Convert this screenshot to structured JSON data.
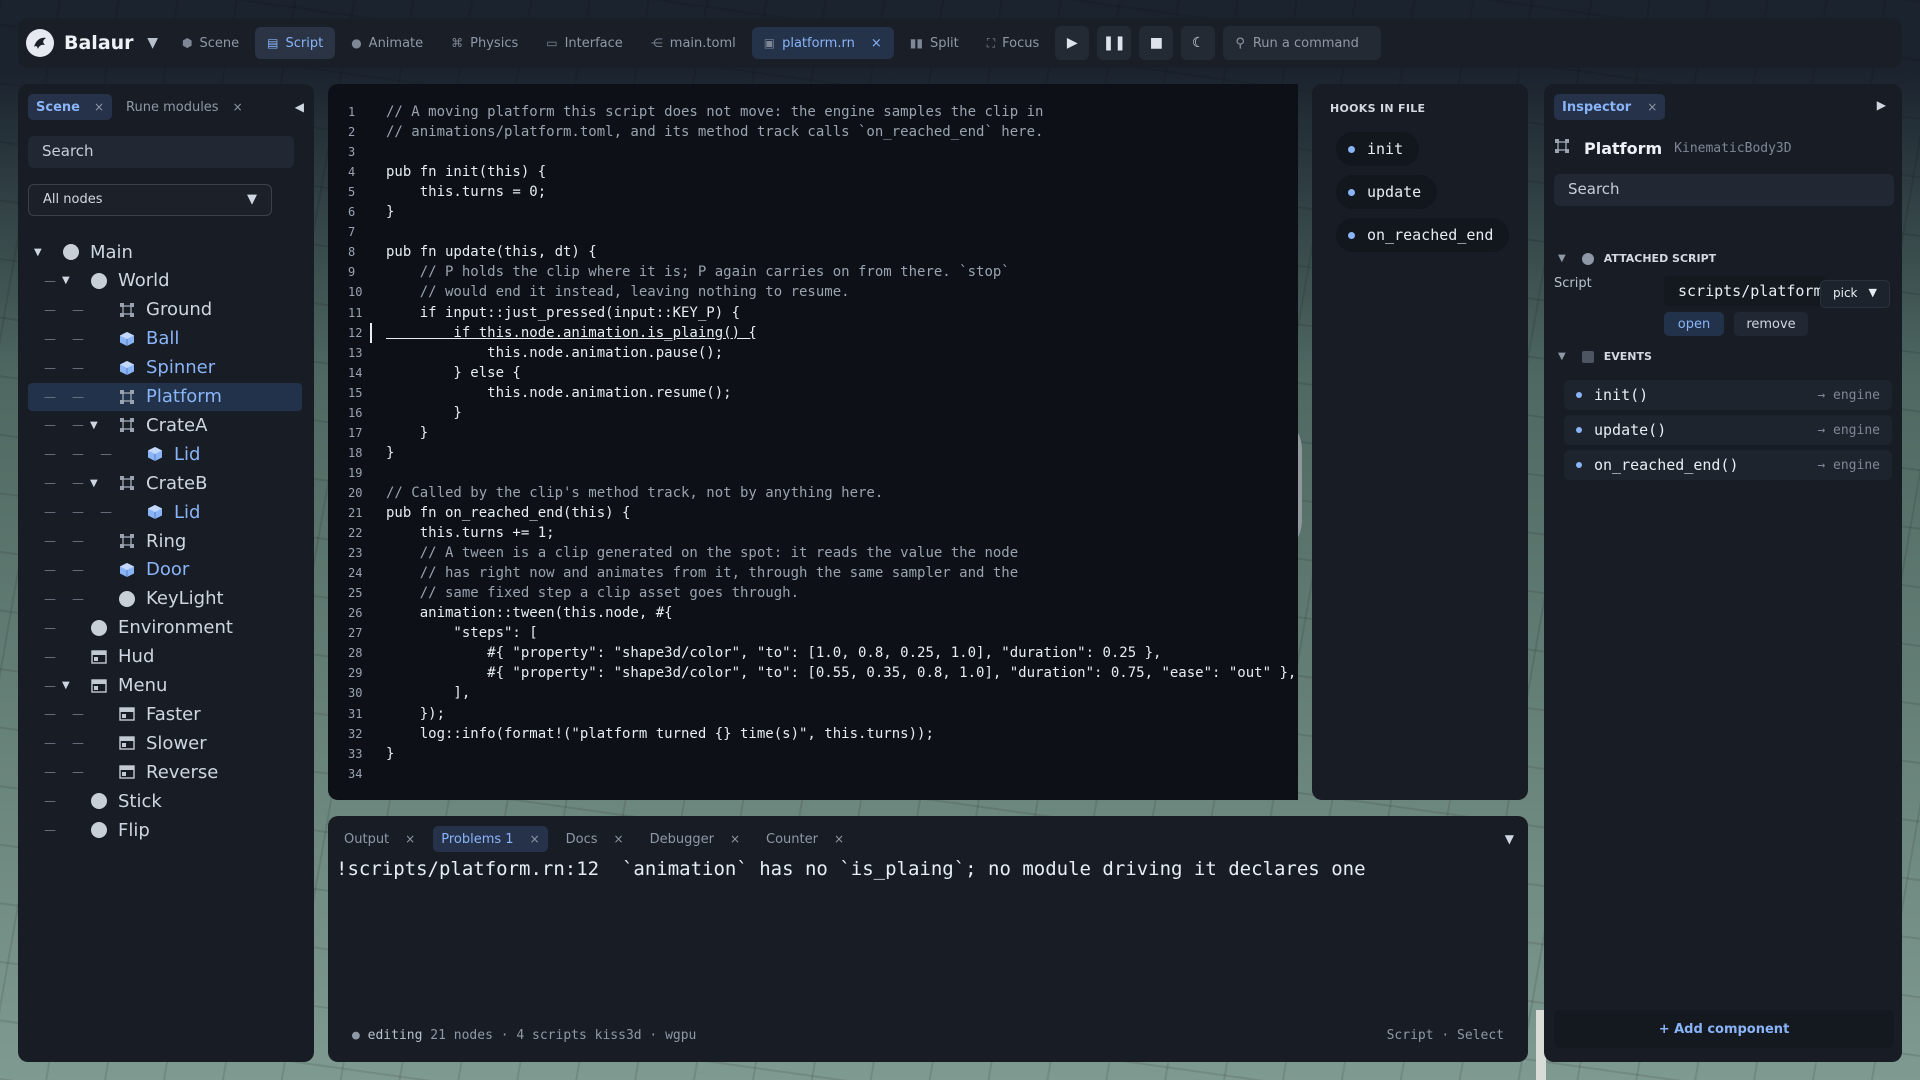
{
  "app": {
    "name": "Balaur"
  },
  "toolbar": {
    "items": [
      {
        "label": "Scene",
        "icon": "cube-icon"
      },
      {
        "label": "Script",
        "icon": "code-icon"
      },
      {
        "label": "Animate",
        "icon": "circle-icon"
      },
      {
        "label": "Physics",
        "icon": "nodes-icon"
      },
      {
        "label": "Interface",
        "icon": "window-icon"
      },
      {
        "label": "main.toml",
        "icon": "graph-icon"
      }
    ],
    "active": "Script",
    "open_file": "platform.rn",
    "split_label": "Split",
    "focus_label": "Focus",
    "command_placeholder": "Run a command"
  },
  "left": {
    "tabs": [
      {
        "label": "Scene"
      },
      {
        "label": "Rune modules"
      }
    ],
    "search_placeholder": "Search",
    "filter_value": "All nodes",
    "tree": [
      {
        "label": "Main",
        "icon": "dot-icon"
      },
      {
        "label": "World",
        "icon": "dot-icon"
      },
      {
        "label": "Ground",
        "icon": "kinematic-icon"
      },
      {
        "label": "Ball",
        "icon": "rigid-body-icon"
      },
      {
        "label": "Spinner",
        "icon": "rigid-body-icon"
      },
      {
        "label": "Platform",
        "icon": "kinematic-icon"
      },
      {
        "label": "CrateA",
        "icon": "kinematic-icon"
      },
      {
        "label": "Lid",
        "icon": "rigid-body-icon"
      },
      {
        "label": "CrateB",
        "icon": "kinematic-icon"
      },
      {
        "label": "Lid",
        "icon": "rigid-body-icon"
      },
      {
        "label": "Ring",
        "icon": "kinematic-icon"
      },
      {
        "label": "Door",
        "icon": "rigid-body-icon"
      },
      {
        "label": "KeyLight",
        "icon": "dot-icon"
      },
      {
        "label": "Environment",
        "icon": "dot-icon"
      },
      {
        "label": "Hud",
        "icon": "ui-icon"
      },
      {
        "label": "Menu",
        "icon": "ui-icon"
      },
      {
        "label": "Faster",
        "icon": "ui-icon"
      },
      {
        "label": "Slower",
        "icon": "ui-icon"
      },
      {
        "label": "Reverse",
        "icon": "ui-icon"
      },
      {
        "label": "Stick",
        "icon": "dot-icon"
      },
      {
        "label": "Flip",
        "icon": "dot-icon"
      }
    ],
    "selected": "Platform"
  },
  "editor": {
    "lines": [
      "// A moving platform this script does not move: the engine samples the clip in",
      "// animations/platform.toml, and its method track calls `on_reached_end` here.",
      "",
      "pub fn init(this) {",
      "    this.turns = 0;",
      "}",
      "",
      "pub fn update(this, dt) {",
      "    // P holds the clip where it is; P again carries on from there. `stop`",
      "    // would end it instead, leaving nothing to resume.",
      "    if input::just_pressed(input::KEY_P) {",
      "        if this.node.animation.is_plaing() {",
      "            this.node.animation.pause();",
      "        } else {",
      "            this.node.animation.resume();",
      "        }",
      "    }",
      "}",
      "",
      "// Called by the clip's method track, not by anything here.",
      "pub fn on_reached_end(this) {",
      "    this.turns += 1;",
      "    // A tween is a clip generated on the spot: it reads the value the node",
      "    // has right now and animates from it, through the same sampler and the",
      "    // same fixed step a clip asset goes through.",
      "    animation::tween(this.node, #{",
      "        \"steps\": [",
      "            #{ \"property\": \"shape3d/color\", \"to\": [1.0, 0.8, 0.25, 1.0], \"duration\": 0.25 },",
      "            #{ \"property\": \"shape3d/color\", \"to\": [0.55, 0.35, 0.8, 1.0], \"duration\": 0.75, \"ease\": \"out\" },",
      "        ],",
      "    });",
      "    log::info(format!(\"platform turned {} time(s)\", this.turns));",
      "}",
      ""
    ],
    "error_line": 12
  },
  "hooks": {
    "title": "HOOKS IN FILE",
    "items": [
      "init",
      "update",
      "on_reached_end"
    ]
  },
  "inspector": {
    "tab": "Inspector",
    "node_name": "Platform",
    "node_type": "KinematicBody3D",
    "search_placeholder": "Search",
    "attached_script": {
      "title": "ATTACHED SCRIPT",
      "label": "Script",
      "path": "scripts/platform.rn",
      "pick_label": "pick",
      "open_label": "open",
      "remove_label": "remove"
    },
    "events": {
      "title": "EVENTS",
      "items": [
        {
          "name": "init()",
          "target": "engine"
        },
        {
          "name": "update()",
          "target": "engine"
        },
        {
          "name": "on_reached_end()",
          "target": "engine"
        }
      ]
    },
    "add_component_label": "+ Add component"
  },
  "bottom": {
    "tabs": [
      "Output",
      "Problems 1",
      "Docs",
      "Debugger",
      "Counter"
    ],
    "active": "Problems 1",
    "problem_text": "!scripts/platform.rn:12  `animation` has no `is_plaing`; no module driving it declares one",
    "status_left_editing": "editing",
    "status_left_rest": "21 nodes · 4 scripts kiss3d · wgpu",
    "status_right": "Script · Select"
  },
  "colors": {
    "accent": "#8ab4f8",
    "panel": "#181d25",
    "editor_bg": "#0d1117"
  }
}
